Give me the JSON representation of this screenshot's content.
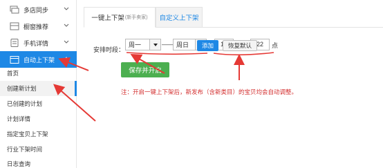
{
  "sidebar": {
    "items": [
      {
        "label": "多店同步",
        "icon": "stack-icon"
      },
      {
        "label": "橱窗推荐",
        "icon": "showcase-icon"
      },
      {
        "label": "手机详情",
        "icon": "phone-icon"
      },
      {
        "label": "自动上下架",
        "icon": "calendar-icon"
      }
    ],
    "subitems": [
      {
        "label": "首页"
      },
      {
        "label": "创建新计划"
      },
      {
        "label": "已创建的计划"
      },
      {
        "label": "计划详情"
      },
      {
        "label": "指定宝贝上下架"
      },
      {
        "label": "行业下架时间"
      },
      {
        "label": "日志查询"
      }
    ]
  },
  "tabs": {
    "active": {
      "label": "一键上下架",
      "note": "(新手卖家)"
    },
    "inactive": {
      "label": "自定义上下架"
    }
  },
  "form": {
    "label": "安排时段：",
    "start_day": "周一",
    "dash": "——",
    "end_day": "周日",
    "start_hour": "10",
    "to_text": "点至",
    "end_hour": "22",
    "end_text": "点",
    "add_label": "添加",
    "reset_label": "恢复默认",
    "save_label": "保存并开启",
    "notice": "注：开启一键上下架后，新发布（含新类目）的宝贝均会自动调整。"
  },
  "colors": {
    "accent": "#1e88e5",
    "save": "#4caf50",
    "annotation": "#e53935",
    "notice": "#d32f2f"
  }
}
